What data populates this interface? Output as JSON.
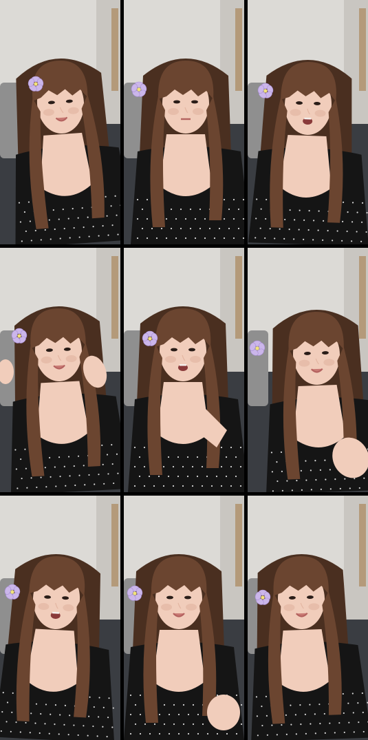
{
  "grid": {
    "rows": 3,
    "columns": 3,
    "frame_count": 9
  },
  "colors": {
    "background": "#000000",
    "wall": "#dcdad6",
    "wall_shadow": "#c9c6c1",
    "sofa": "#3a3d42",
    "cushion": "#8f8f8f",
    "hair": "#6b4530",
    "hair_dark": "#4a2f20",
    "skin": "#f1cdbb",
    "skin_shade": "#e3b6a2",
    "top": "#151515",
    "dots": "#d8d8d8",
    "flower": "#cbb6ea",
    "flower_center": "#f2e27a",
    "frame_wood": "#b49a7a"
  },
  "frames": [
    {
      "pose": "smiling-flower-left",
      "flower": true,
      "hand": "none"
    },
    {
      "pose": "neutral-flower-left",
      "flower": true,
      "hand": "none"
    },
    {
      "pose": "talking-flower-left",
      "flower": true,
      "hand": "none"
    },
    {
      "pose": "hand-in-hair",
      "flower": true,
      "hand": "raised-right"
    },
    {
      "pose": "praying-hands",
      "flower": true,
      "hand": "praying"
    },
    {
      "pose": "smiling-hand-forward",
      "flower": true,
      "hand": "forward-right"
    },
    {
      "pose": "open-mouth-talking",
      "flower": true,
      "hand": "none"
    },
    {
      "pose": "smiling-hand-lower",
      "flower": true,
      "hand": "lower-right"
    },
    {
      "pose": "smiling-tilted",
      "flower": true,
      "hand": "none"
    }
  ]
}
